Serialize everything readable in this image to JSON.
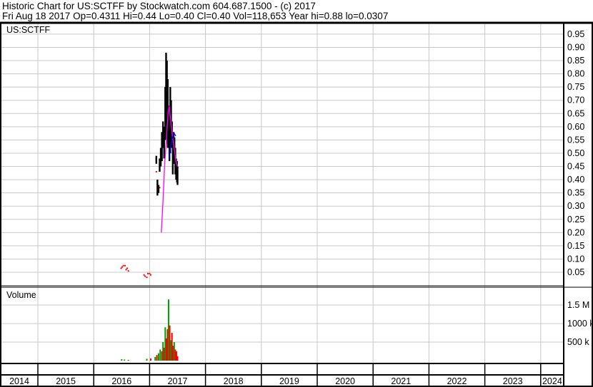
{
  "header": {
    "title": "Historic Chart for US:SCTFF by Stockwatch.com 604.687.1500 - (c) 2017",
    "quote": "Fri Aug 18 2017  Op=0.4311  Hi=0.44  Lo=0.40  Cl=0.40  Vol=118,653  Year hi=0.88  lo=0.0307"
  },
  "colors": {
    "grid": "#c8c8c8",
    "bar": "#000000",
    "ma_short": "#ff00ff",
    "ma_long": "#0000ff",
    "vol_up": "#00a000",
    "vol_down": "#ff0000",
    "dot": "#ff0000"
  },
  "chart_data": [
    {
      "type": "line",
      "title": "US:SCTFF",
      "ylim": [
        0,
        0.97
      ],
      "y_ticks": [
        "0.95",
        "0.90",
        "0.85",
        "0.80",
        "0.75",
        "0.70",
        "0.65",
        "0.60",
        "0.55",
        "0.50",
        "0.45",
        "0.40",
        "0.35",
        "0.30",
        "0.25",
        "0.20",
        "0.15",
        "0.10",
        "0.05"
      ],
      "x_ticks": [
        "2014",
        "2015",
        "2016",
        "2017",
        "2018",
        "2019",
        "2020",
        "2021",
        "2022",
        "2023",
        "2024"
      ],
      "bars": [
        [
          2017.12,
          0.49,
          0.46
        ],
        [
          2017.14,
          0.4,
          0.34
        ],
        [
          2017.16,
          0.38,
          0.35
        ],
        [
          2017.18,
          0.48,
          0.43
        ],
        [
          2017.2,
          0.52,
          0.45
        ],
        [
          2017.22,
          0.58,
          0.47
        ],
        [
          2017.24,
          0.62,
          0.52
        ],
        [
          2017.26,
          0.6,
          0.48
        ],
        [
          2017.28,
          0.75,
          0.55
        ],
        [
          2017.295,
          0.88,
          0.6
        ],
        [
          2017.31,
          0.85,
          0.56
        ],
        [
          2017.325,
          0.78,
          0.52
        ],
        [
          2017.34,
          0.68,
          0.52
        ],
        [
          2017.355,
          0.6,
          0.47
        ],
        [
          2017.37,
          0.75,
          0.5
        ],
        [
          2017.385,
          0.7,
          0.55
        ],
        [
          2017.4,
          0.62,
          0.52
        ],
        [
          2017.415,
          0.55,
          0.42
        ],
        [
          2017.43,
          0.58,
          0.48
        ],
        [
          2017.445,
          0.56,
          0.46
        ],
        [
          2017.46,
          0.52,
          0.42
        ],
        [
          2017.475,
          0.48,
          0.4
        ],
        [
          2017.49,
          0.47,
          0.39
        ],
        [
          2017.5,
          0.45,
          0.38
        ]
      ],
      "dots": [
        [
          2016.49,
          0.065
        ],
        [
          2016.51,
          0.07
        ],
        [
          2016.53,
          0.075
        ],
        [
          2016.56,
          0.075
        ],
        [
          2016.58,
          0.06
        ],
        [
          2016.6,
          0.065
        ],
        [
          2016.62,
          0.055
        ],
        [
          2016.9,
          0.04
        ],
        [
          2016.92,
          0.035
        ],
        [
          2016.95,
          0.0307
        ],
        [
          2016.97,
          0.045
        ],
        [
          2017.0,
          0.045
        ],
        [
          2017.02,
          0.04
        ],
        [
          2017.12,
          0.43
        ],
        [
          2017.18,
          0.37
        ]
      ],
      "ma_short": [
        [
          2017.21,
          0.2
        ],
        [
          2017.24,
          0.32
        ],
        [
          2017.27,
          0.46
        ],
        [
          2017.3,
          0.55
        ],
        [
          2017.33,
          0.65
        ],
        [
          2017.35,
          0.68
        ],
        [
          2017.38,
          0.62
        ],
        [
          2017.41,
          0.56
        ],
        [
          2017.44,
          0.52
        ],
        [
          2017.47,
          0.47
        ],
        [
          2017.5,
          0.45
        ]
      ],
      "ma_long": [
        [
          2017.35,
          0.48
        ],
        [
          2017.38,
          0.53
        ],
        [
          2017.41,
          0.56
        ],
        [
          2017.44,
          0.575
        ],
        [
          2017.47,
          0.565
        ]
      ]
    },
    {
      "type": "bar",
      "title": "Volume",
      "ylim": [
        0,
        1.9
      ],
      "y_ticks": [
        {
          "label": "1.5 M",
          "value": 1.5
        },
        {
          "label": "1000 k",
          "value": 1.0
        },
        {
          "label": "500 k",
          "value": 0.5
        }
      ],
      "values": [
        [
          2016.5,
          0.04,
          "up"
        ],
        [
          2016.55,
          0.03,
          "up"
        ],
        [
          2016.62,
          0.02,
          "down"
        ],
        [
          2016.95,
          0.05,
          "up"
        ],
        [
          2017.02,
          0.06,
          "down"
        ],
        [
          2017.1,
          0.1,
          "up"
        ],
        [
          2017.13,
          0.15,
          "down"
        ],
        [
          2017.16,
          0.2,
          "up"
        ],
        [
          2017.19,
          0.3,
          "up"
        ],
        [
          2017.22,
          0.25,
          "down"
        ],
        [
          2017.24,
          0.5,
          "up"
        ],
        [
          2017.26,
          0.35,
          "down"
        ],
        [
          2017.28,
          0.9,
          "up"
        ],
        [
          2017.3,
          0.6,
          "down"
        ],
        [
          2017.32,
          0.85,
          "down"
        ],
        [
          2017.34,
          1.65,
          "up"
        ],
        [
          2017.36,
          0.95,
          "down"
        ],
        [
          2017.38,
          0.55,
          "up"
        ],
        [
          2017.4,
          0.75,
          "down"
        ],
        [
          2017.42,
          0.4,
          "down"
        ],
        [
          2017.44,
          0.5,
          "up"
        ],
        [
          2017.46,
          0.3,
          "down"
        ],
        [
          2017.48,
          0.25,
          "down"
        ],
        [
          2017.5,
          0.12,
          "down"
        ]
      ]
    }
  ]
}
